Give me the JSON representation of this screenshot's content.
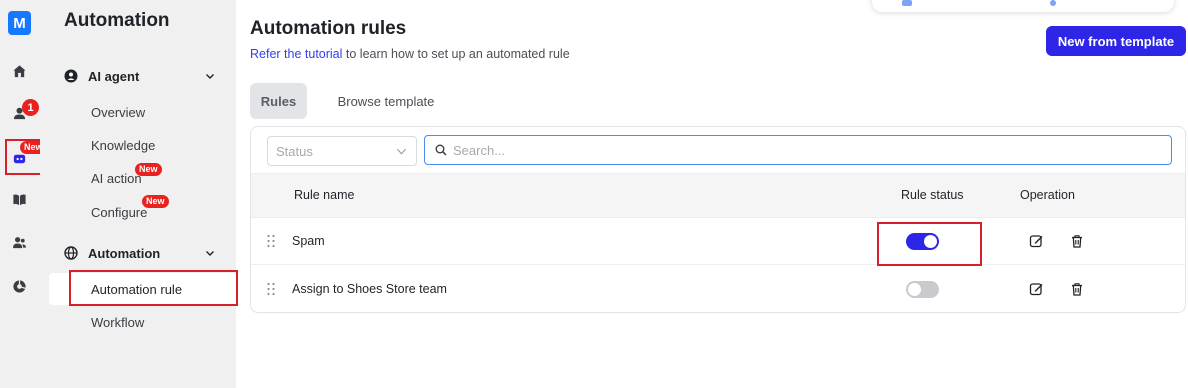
{
  "rail": {
    "logo": "M",
    "badge_count": "1",
    "badge_new": "New",
    "icons": [
      "home-icon",
      "inbox-icon",
      "bot-icon",
      "book-icon",
      "users-icon",
      "analytics-icon"
    ]
  },
  "nav": {
    "title": "Automation",
    "ai_agent": {
      "label": "AI agent",
      "items": [
        {
          "label": "Overview"
        },
        {
          "label": "Knowledge"
        },
        {
          "label": "AI action",
          "badge": "New"
        },
        {
          "label": "Configure",
          "badge": "New"
        }
      ]
    },
    "automation": {
      "label": "Automation",
      "items": [
        {
          "label": "Automation rule",
          "active": true
        },
        {
          "label": "Workflow"
        }
      ]
    }
  },
  "main": {
    "title": "Automation rules",
    "subtitle_link": "Refer the tutorial",
    "subtitle_rest": " to learn how to set up an automated rule",
    "new_button": "New from template",
    "tabs": [
      {
        "label": "Rules",
        "active": true
      },
      {
        "label": "Browse template",
        "active": false
      }
    ],
    "filter": {
      "status_placeholder": "Status",
      "search_placeholder": "Search..."
    },
    "table": {
      "headers": {
        "rule_name": "Rule name",
        "rule_status": "Rule status",
        "operation": "Operation"
      },
      "rows": [
        {
          "name": "Spam",
          "enabled": true
        },
        {
          "name": "Assign to Shoes Store team",
          "enabled": false
        }
      ]
    }
  },
  "colors": {
    "accent": "#2d26e6",
    "link": "#2f3ff0",
    "highlight_border": "#d71f28",
    "badge": "#e8221f",
    "logo": "#1677ff"
  }
}
